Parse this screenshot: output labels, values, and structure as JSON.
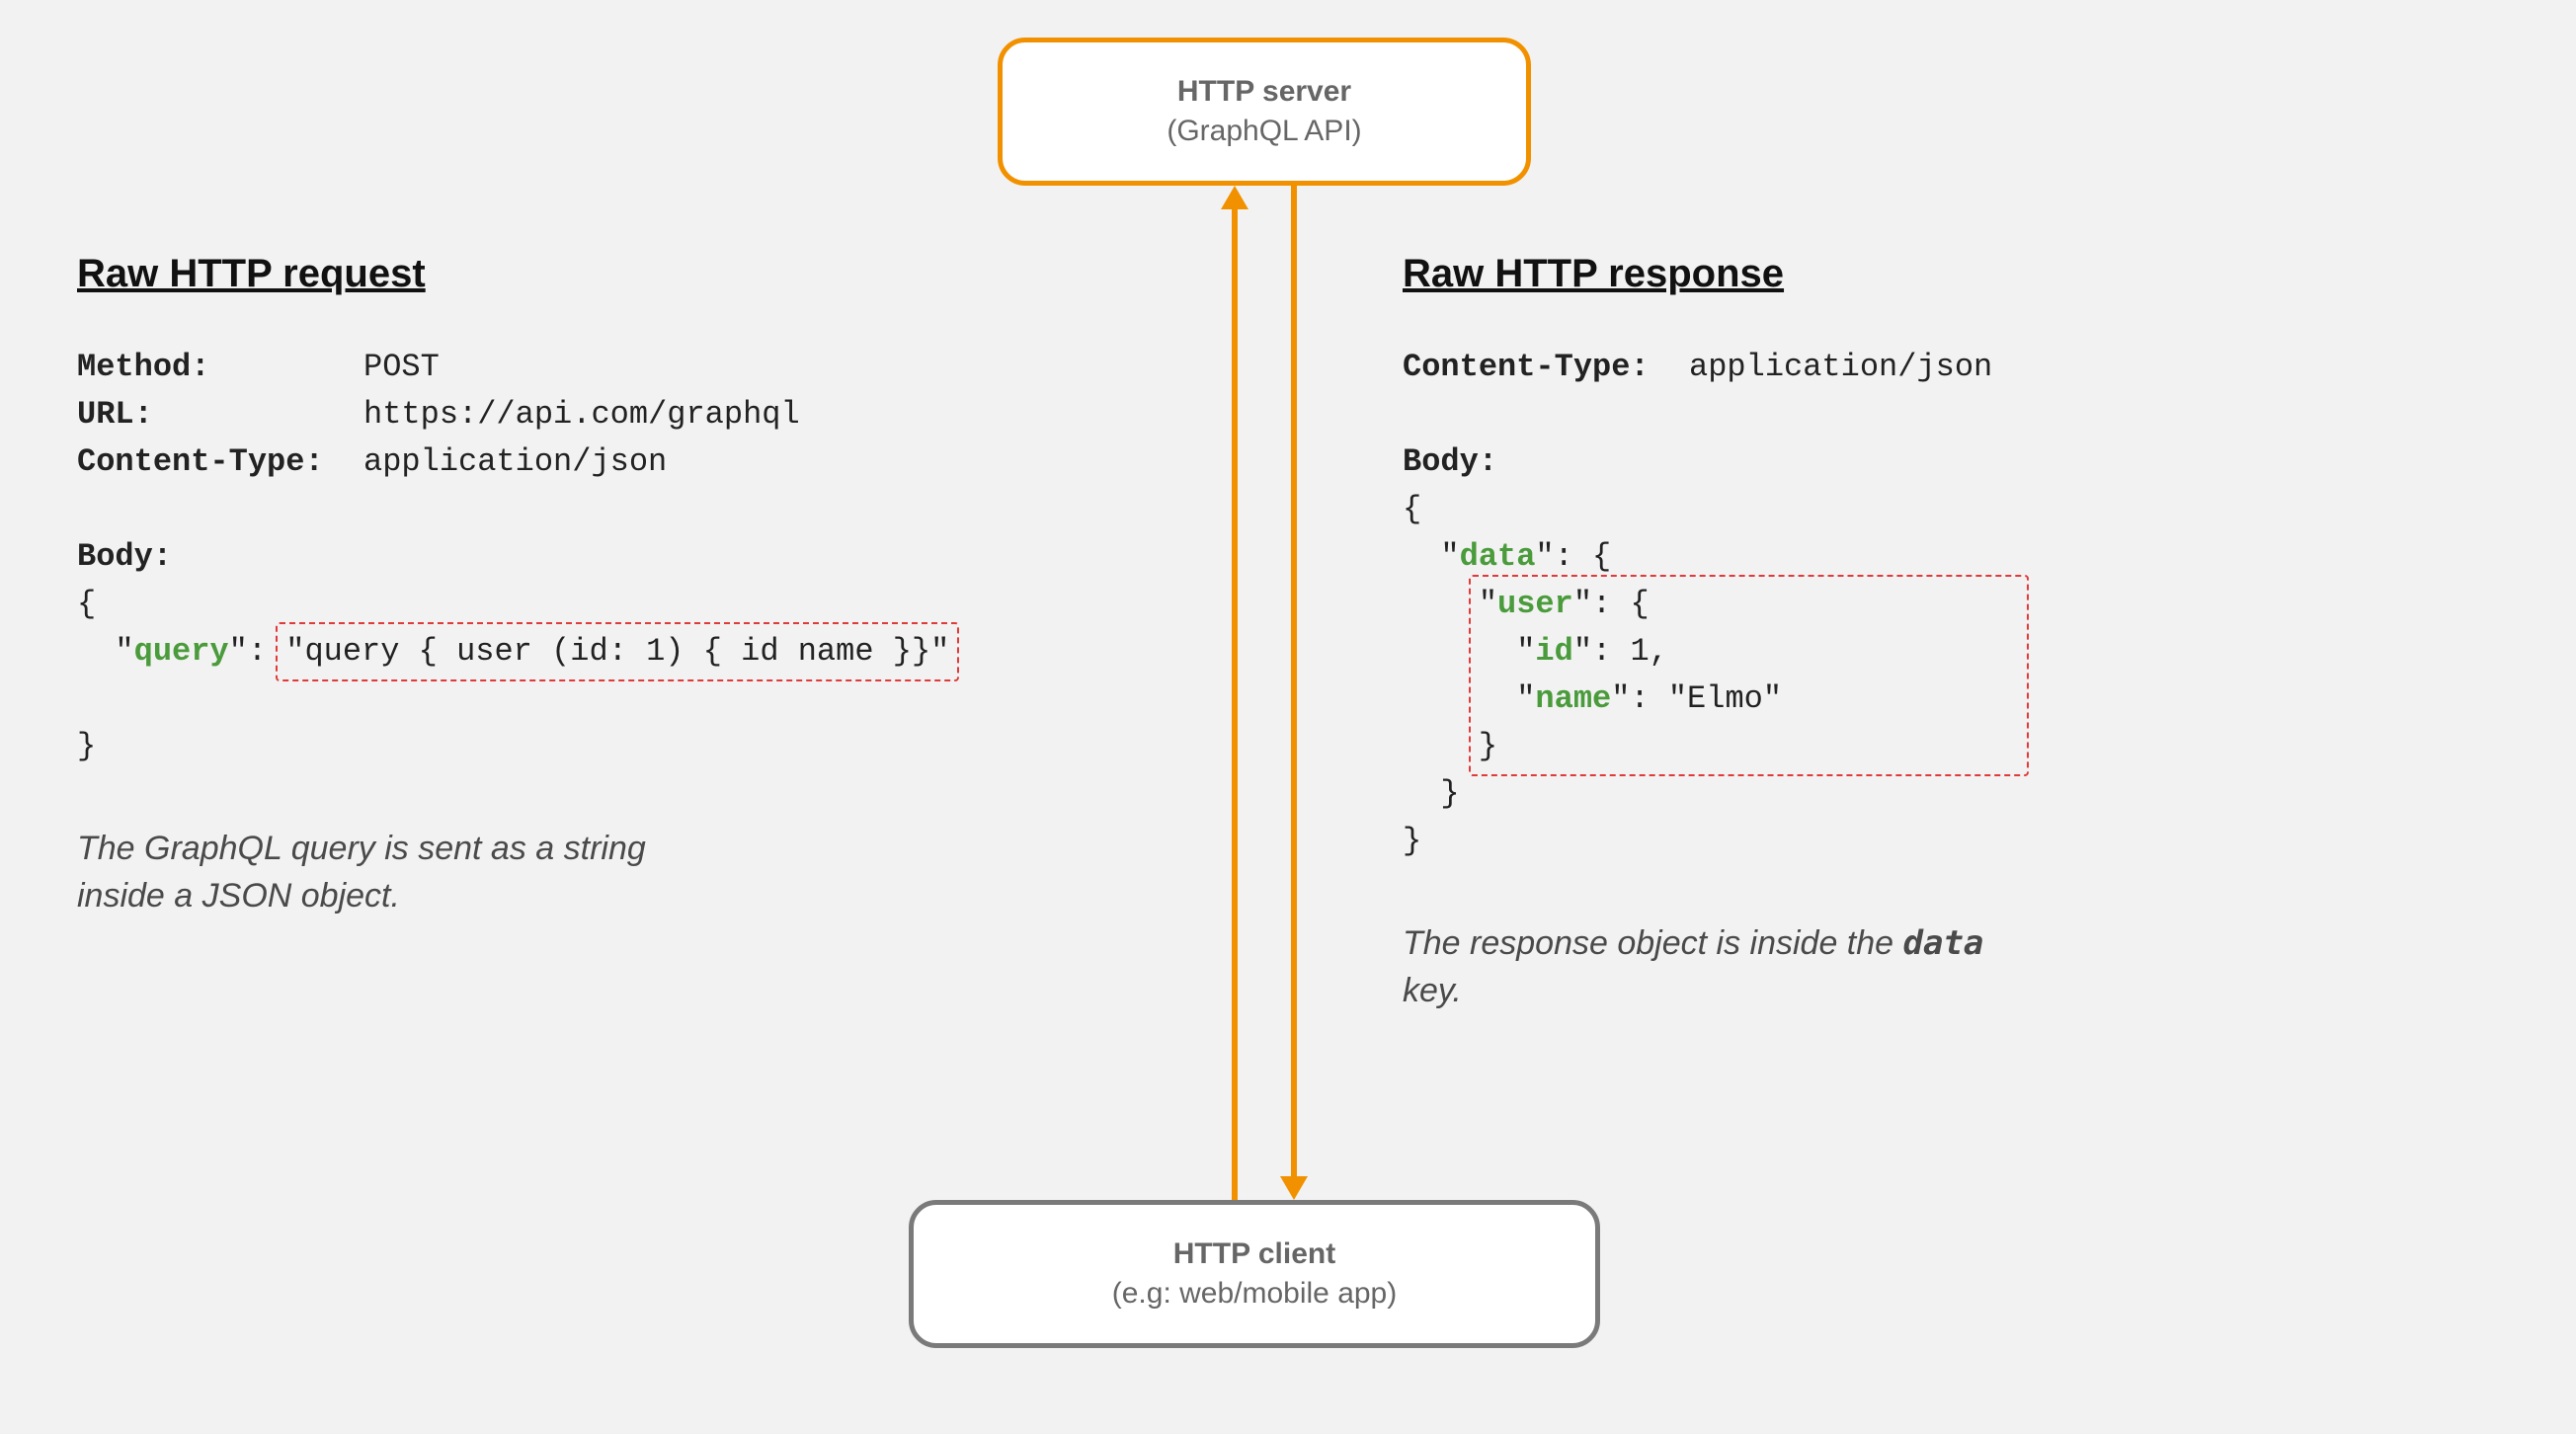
{
  "server": {
    "title": "HTTP server",
    "subtitle": "(GraphQL API)"
  },
  "client": {
    "title": "HTTP client",
    "subtitle": "(e.g: web/mobile app)"
  },
  "request": {
    "heading": "Raw HTTP request",
    "method_label": "Method:",
    "method_value": "POST",
    "url_label": "URL:",
    "url_value": "https://api.com/graphql",
    "ct_label": "Content-Type:",
    "ct_value": "application/json",
    "body_label": "Body:",
    "body_open": "{",
    "body_indent": "  \"",
    "body_key": "query",
    "body_after_key": "\": ",
    "body_query_string": "\"query { user (id: 1) { id name }}\"",
    "body_close": "}",
    "caption": "The GraphQL query is sent as a string\ninside a JSON object."
  },
  "response": {
    "heading": "Raw HTTP response",
    "ct_label": "Content-Type:",
    "ct_value": "application/json",
    "body_label": "Body:",
    "open1": "{",
    "l2_pre": "  \"",
    "l2_key": "data",
    "l2_post": "\": {",
    "l3_pre": "\"",
    "l3_key": "user",
    "l3_post": "\": {",
    "l4_pre": "  \"",
    "l4_key": "id",
    "l4_post": "\": 1,",
    "l5_pre": "  \"",
    "l5_key": "name",
    "l5_post": "\": \"Elmo\"",
    "l6": "}",
    "close2": "  }",
    "close1": "}",
    "caption_a": "The response object is inside the ",
    "caption_key": "data",
    "caption_b": "\nkey."
  },
  "colors": {
    "accent": "#f29100",
    "dashed": "#e03a3a",
    "key": "#4a9b3b"
  }
}
